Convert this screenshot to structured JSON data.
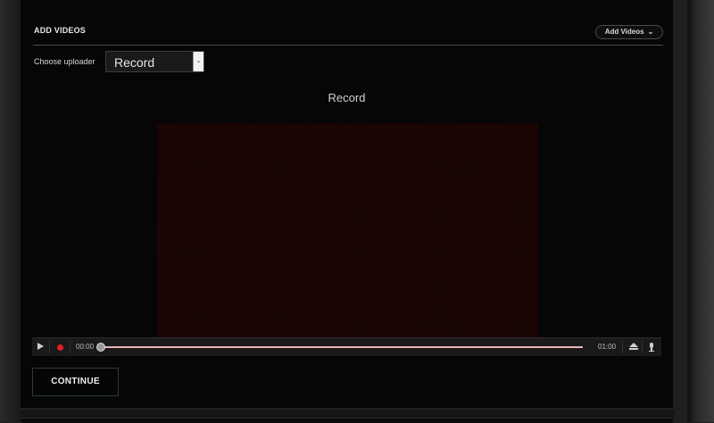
{
  "header": {
    "title": "ADD VIDEOS",
    "add_button_label": "Add Videos",
    "add_button_icon": "chevron-down-icon"
  },
  "uploader": {
    "label": "Choose uploader",
    "selected": "Record"
  },
  "recorder": {
    "heading": "Record",
    "time_current": "00:00",
    "time_total": "01:00",
    "progress": 0,
    "icons": [
      "play-icon",
      "record-icon",
      "eject-icon",
      "microphone-icon"
    ]
  },
  "actions": {
    "continue_label": "CONTINUE"
  },
  "colors": {
    "panel_bg": "#060606",
    "record_red": "#e02020",
    "track": "#e8b4b4",
    "video_bg": "#180404"
  }
}
